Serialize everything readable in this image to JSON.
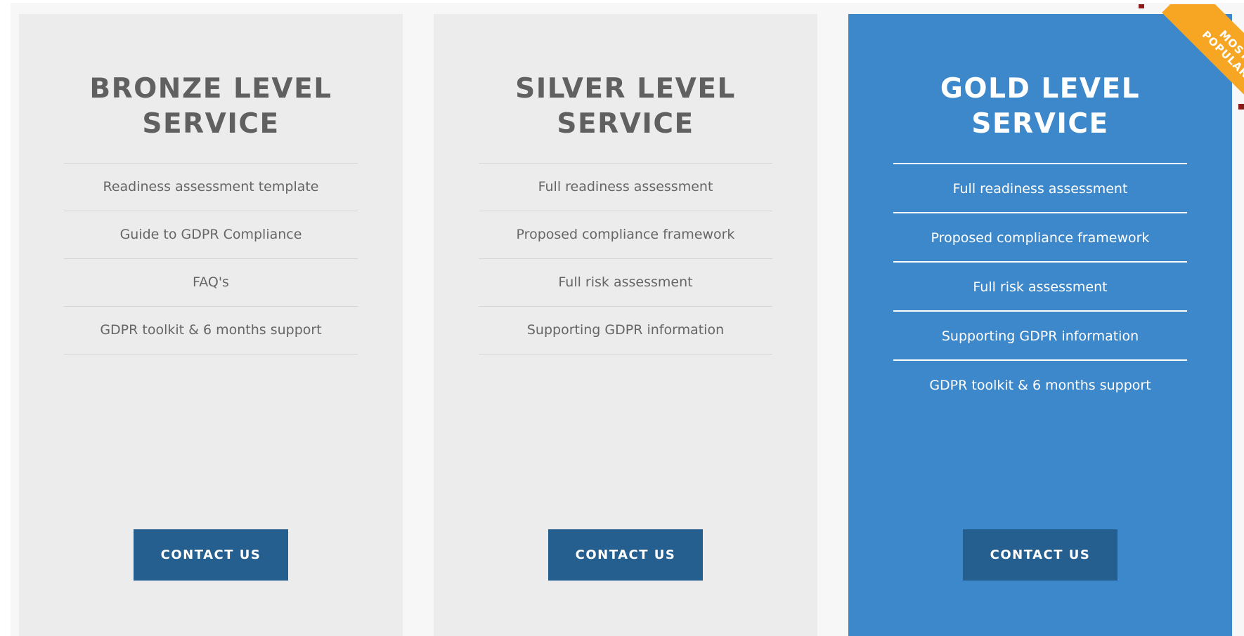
{
  "plans": [
    {
      "title_line1": "BRONZE LEVEL",
      "title_line2": "SERVICE",
      "features": [
        "Readiness assessment template",
        "Guide to GDPR Compliance",
        "FAQ's",
        "GDPR toolkit & 6 months support"
      ],
      "cta_label": "CONTACT US"
    },
    {
      "title_line1": "SILVER LEVEL",
      "title_line2": "SERVICE",
      "features": [
        "Full readiness assessment",
        "Proposed compliance framework",
        "Full risk assessment",
        "Supporting GDPR information"
      ],
      "cta_label": "CONTACT US"
    },
    {
      "title_line1": "GOLD LEVEL",
      "title_line2": "SERVICE",
      "features": [
        "Full readiness assessment",
        "Proposed compliance framework",
        "Full risk assessment",
        "Supporting GDPR information",
        "GDPR toolkit & 6 months support"
      ],
      "cta_label": "CONTACT US",
      "ribbon_line1": "MOST",
      "ribbon_line2": "POPULAR"
    }
  ],
  "colors": {
    "card_bg": "#ececec",
    "highlight_bg": "#3d88ca",
    "button_bg": "#255f8f",
    "ribbon_bg": "#f6a623",
    "title_text": "#606060"
  }
}
